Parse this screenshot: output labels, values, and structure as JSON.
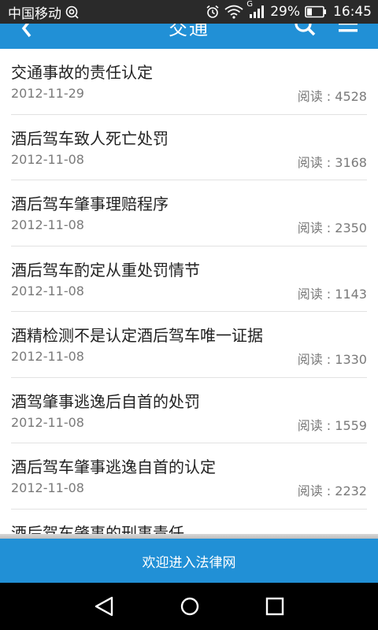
{
  "status_bar": {
    "carrier": "中国移动",
    "network_type": "G",
    "battery_percent": "29%",
    "time": "16:45"
  },
  "header": {
    "title": "交通"
  },
  "articles": [
    {
      "title": "交通事故的责任认定",
      "date": "2012-11-29",
      "reads": "阅读 : 4528"
    },
    {
      "title": "酒后驾车致人死亡处罚",
      "date": "2012-11-08",
      "reads": "阅读 : 3168"
    },
    {
      "title": "酒后驾车肇事理赔程序",
      "date": "2012-11-08",
      "reads": "阅读 : 2350"
    },
    {
      "title": "酒后驾车酌定从重处罚情节",
      "date": "2012-11-08",
      "reads": "阅读 : 1143"
    },
    {
      "title": "酒精检测不是认定酒后驾车唯一证据",
      "date": "2012-11-08",
      "reads": "阅读 : 1330"
    },
    {
      "title": "酒驾肇事逃逸后自首的处罚",
      "date": "2012-11-08",
      "reads": "阅读 : 1559"
    },
    {
      "title": "酒后驾车肇事逃逸自首的认定",
      "date": "2012-11-08",
      "reads": "阅读 : 2232"
    },
    {
      "title": "酒后驾车肇事的刑事责任",
      "date": "",
      "reads": ""
    }
  ],
  "footer": {
    "banner_text": "欢迎进入法律网"
  },
  "colors": {
    "accent": "#2190d6",
    "status_bar_bg": "#2a2a2a",
    "text_primary": "#222222",
    "text_secondary": "#7a7a7a"
  },
  "icons": {
    "status_left": [
      "location-icon"
    ],
    "status_right": [
      "alarm-icon",
      "wifi-icon",
      "signal-icon",
      "battery-icon"
    ],
    "header": [
      "back-arrow-icon",
      "search-icon",
      "menu-icon"
    ],
    "nav": [
      "nav-back-icon",
      "nav-home-icon",
      "nav-recent-icon"
    ]
  }
}
